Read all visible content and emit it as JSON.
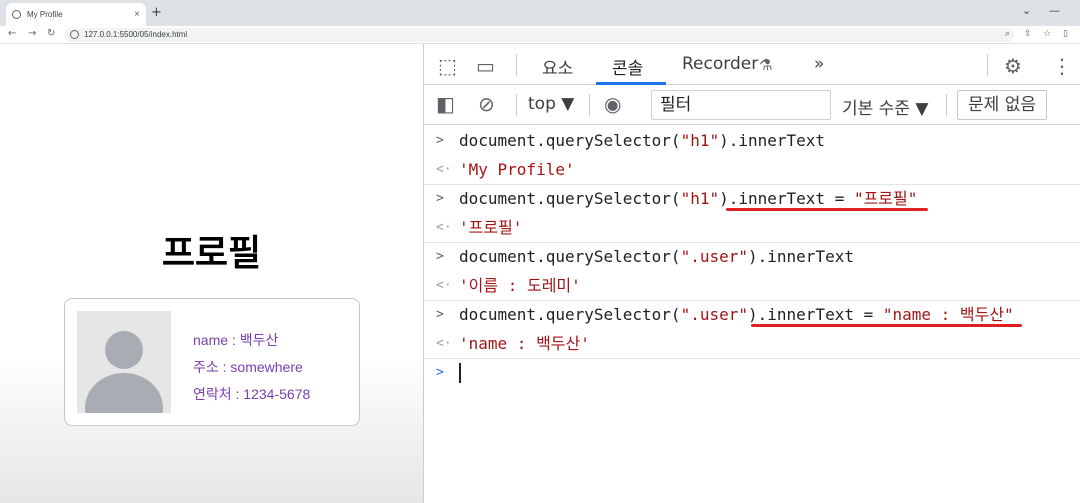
{
  "browser": {
    "tab_title": "My Profile",
    "tab_close": "×",
    "new_tab": "+",
    "url": "127.0.0.1:5500/05/index.html",
    "window_controls": [
      "⌄",
      "—"
    ]
  },
  "page": {
    "heading": "프로필",
    "user": {
      "name": "name : 백두산",
      "address": "주소 : somewhere",
      "contact": "연락처 : 1234-5678"
    }
  },
  "devtools": {
    "tabs": [
      "요소",
      "콘솔",
      "Recorder"
    ],
    "active_tab": "콘솔",
    "more_tabs": "»",
    "context": "top",
    "filter_value": "필터",
    "level_select": "기본 수준",
    "issues_button": "문제 없음",
    "console": [
      {
        "kind": "input",
        "pre": "document.querySelector(",
        "str": "\"h1\"",
        "post": ").innerText"
      },
      {
        "kind": "result",
        "text": "'My Profile'"
      },
      {
        "kind": "input",
        "pre": "document.querySelector(",
        "str": "\"h1\"",
        "post": ").innerText = ",
        "str2": "\"프로필\""
      },
      {
        "kind": "result",
        "text": "'프로필'"
      },
      {
        "kind": "input",
        "pre": "document.querySelector(",
        "str": "\".user\"",
        "post": ").innerText"
      },
      {
        "kind": "result",
        "text": "'이름 : 도레미'"
      },
      {
        "kind": "input",
        "pre": "document.querySelector(",
        "str": "\".user\"",
        "post": ").innerText = ",
        "str2": "\"name : 백두산\""
      },
      {
        "kind": "result",
        "text": "'name : 백두산'"
      }
    ]
  },
  "colors": {
    "user_text": "#7b3fb0",
    "string_literal": "#a31515",
    "active_tab_underline": "#1a73e8",
    "annotation_underline": "#e02020"
  }
}
